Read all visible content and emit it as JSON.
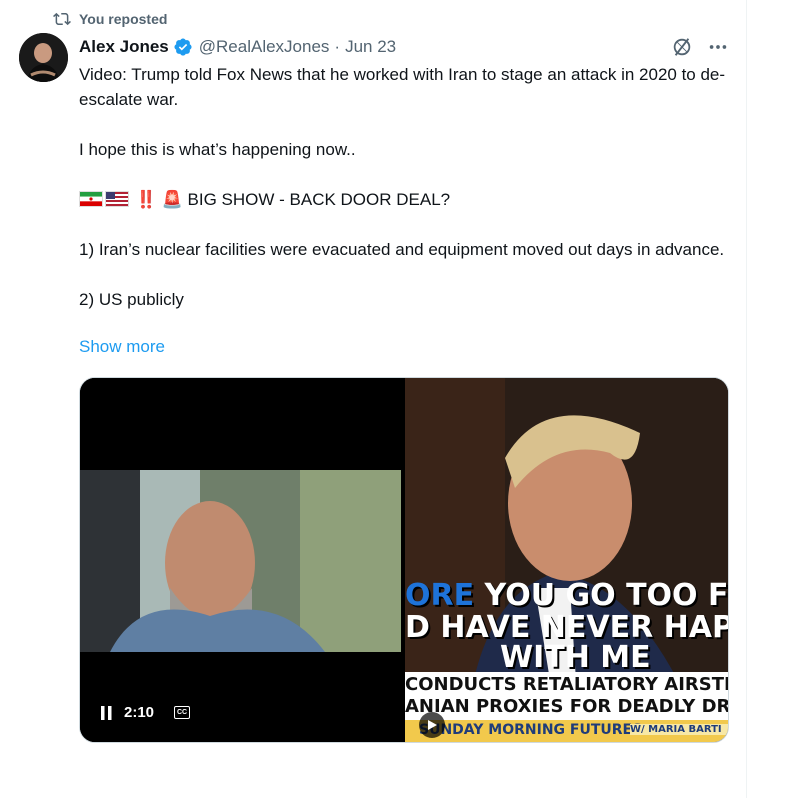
{
  "repost": {
    "label": "You reposted"
  },
  "author": {
    "name": "Alex Jones",
    "handle": "@RealAlexJones",
    "separator": "·",
    "date": "Jun 23"
  },
  "tweet": {
    "lines": [
      "Video: Trump told Fox News that he worked with Iran to stage an attack in 2020 to de-escalate war.",
      "I hope this is what’s happening now..",
      "‼️ 🚨 BIG SHOW - BACK DOOR DEAL?",
      "1) Iran’s nuclear facilities were evacuated and equipment moved out days in advance.",
      "2) US publicly"
    ],
    "show_more": "Show more"
  },
  "video": {
    "time": "2:10",
    "cc": "CC",
    "caption_line1_blue": "ORE",
    "caption_line1": " YOU GO TOO F",
    "caption_line2": "D HAVE NEVER HAP",
    "caption_line3": "WITH ME",
    "ticker1": "CONDUCTS RETALIATORY AIRSTRIKE",
    "ticker2": "ANIAN PROXIES FOR DEADLY DRON",
    "show_name": "SUNDAY MORNING FUTURES",
    "host_tag": "w/ MARIA BARTI"
  },
  "colors": {
    "accent": "#1d9bf0",
    "muted": "#536471",
    "text": "#0f1419",
    "verified": "#1d9bf0"
  }
}
